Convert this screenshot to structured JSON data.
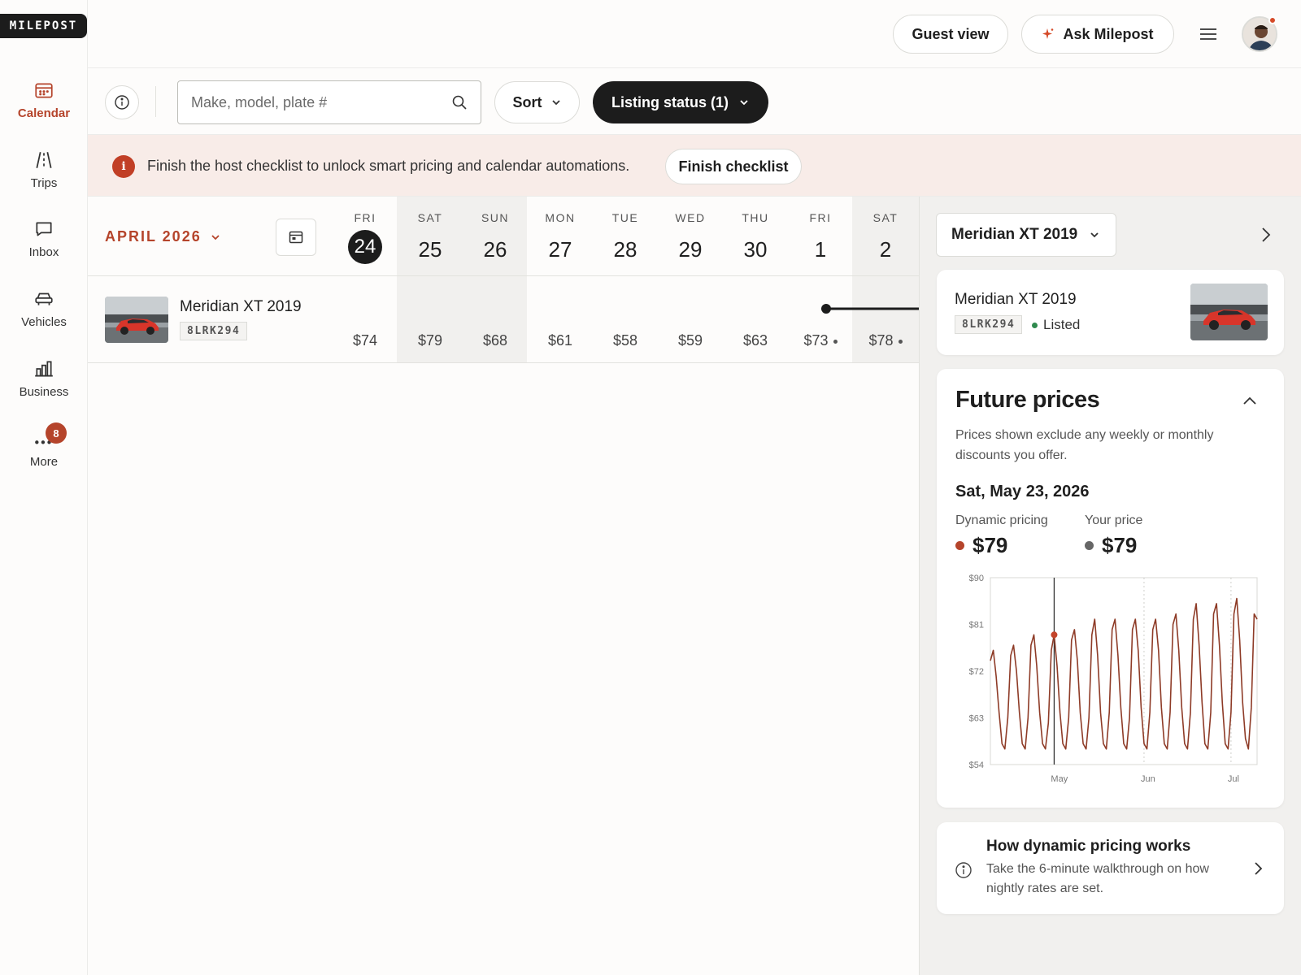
{
  "brand": {
    "logo": "MILEPOST"
  },
  "sidebar": {
    "items": [
      {
        "label": "Calendar",
        "icon": "calendar-icon",
        "active": true
      },
      {
        "label": "Trips",
        "icon": "road-icon"
      },
      {
        "label": "Inbox",
        "icon": "chat-icon"
      },
      {
        "label": "Vehicles",
        "icon": "car-icon"
      },
      {
        "label": "Business",
        "icon": "bar-chart-icon"
      },
      {
        "label": "More",
        "icon": "more-icon",
        "badge": "8"
      }
    ]
  },
  "header": {
    "guest_view": "Guest view",
    "ask": "Ask Milepost",
    "menu_icon": "hamburger-icon"
  },
  "filters": {
    "search_placeholder": "Make, model, plate #",
    "sort": "Sort",
    "listing_status": "Listing status (1)"
  },
  "banner": {
    "icon_text": "i",
    "text": "Finish the host checklist to unlock smart pricing and calendar automations.",
    "button": "Finish checklist"
  },
  "calendar": {
    "month": "APRIL 2026",
    "days": [
      {
        "dow": "FRI",
        "num": "24",
        "today": true
      },
      {
        "dow": "SAT",
        "num": "25",
        "weekend": true
      },
      {
        "dow": "SUN",
        "num": "26",
        "weekend": true
      },
      {
        "dow": "MON",
        "num": "27"
      },
      {
        "dow": "TUE",
        "num": "28"
      },
      {
        "dow": "WED",
        "num": "29"
      },
      {
        "dow": "THU",
        "num": "30"
      },
      {
        "dow": "FRI",
        "num": "1"
      },
      {
        "dow": "SAT",
        "num": "2",
        "weekend": true
      }
    ],
    "vehicle": {
      "name": "Meridian XT 2019",
      "plate": "8LRK294",
      "prices": [
        "$74",
        "$79",
        "$68",
        "$61",
        "$58",
        "$59",
        "$63",
        "$73",
        "$78"
      ],
      "price_dot_indices": [
        7,
        8
      ]
    }
  },
  "panel": {
    "vehicle_select": "Meridian XT 2019",
    "vehicle_card": {
      "name": "Meridian XT 2019",
      "plate": "8LRK294",
      "status": "Listed",
      "status_color": "#2f8a4e"
    },
    "future_prices": {
      "title": "Future prices",
      "subtitle": "Prices shown exclude any weekly or monthly discounts you offer.",
      "date": "Sat, May 23, 2026",
      "dynamic_label": "Dynamic pricing",
      "dynamic_value": "$79",
      "dynamic_color": "#b5442b",
      "your_label": "Your price",
      "your_value": "$79",
      "your_color": "#666666"
    },
    "how": {
      "title": "How dynamic pricing works",
      "subtitle": "Take the 6-minute walkthrough on how nightly rates are set."
    }
  },
  "chart_data": {
    "type": "line",
    "y_tick_labels": [
      "$90",
      "$81",
      "$72",
      "$63",
      "$54"
    ],
    "ylim": [
      54,
      90
    ],
    "x_tick_labels": [
      "May",
      "Jun",
      "Jul"
    ],
    "x_tick_days": [
      0,
      31,
      61
    ],
    "x_range_days": [
      -22,
      70
    ],
    "grid": "dashed vertical at month starts",
    "cursor_day": 0,
    "marker": {
      "day": 0,
      "value": 79
    },
    "line_color": "#8e3b27",
    "series": [
      {
        "points": [
          [
            -22,
            74
          ],
          [
            -21,
            76
          ],
          [
            -20,
            71
          ],
          [
            -19,
            64
          ],
          [
            -18,
            58
          ],
          [
            -17,
            57
          ],
          [
            -16,
            63
          ],
          [
            -15,
            75
          ],
          [
            -14,
            77
          ],
          [
            -13,
            72
          ],
          [
            -12,
            64
          ],
          [
            -11,
            58
          ],
          [
            -10,
            57
          ],
          [
            -9,
            63
          ],
          [
            -8,
            77
          ],
          [
            -7,
            79
          ],
          [
            -6,
            73
          ],
          [
            -5,
            64
          ],
          [
            -4,
            58
          ],
          [
            -3,
            57
          ],
          [
            -2,
            62
          ],
          [
            -1,
            76
          ],
          [
            0,
            79
          ],
          [
            1,
            73
          ],
          [
            2,
            64
          ],
          [
            3,
            58
          ],
          [
            4,
            57
          ],
          [
            5,
            63
          ],
          [
            6,
            78
          ],
          [
            7,
            80
          ],
          [
            8,
            74
          ],
          [
            9,
            64
          ],
          [
            10,
            58
          ],
          [
            11,
            57
          ],
          [
            12,
            63
          ],
          [
            13,
            79
          ],
          [
            14,
            82
          ],
          [
            15,
            75
          ],
          [
            16,
            64
          ],
          [
            17,
            58
          ],
          [
            18,
            57
          ],
          [
            19,
            64
          ],
          [
            20,
            80
          ],
          [
            21,
            82
          ],
          [
            22,
            75
          ],
          [
            23,
            65
          ],
          [
            24,
            58
          ],
          [
            25,
            57
          ],
          [
            26,
            63
          ],
          [
            27,
            80
          ],
          [
            28,
            82
          ],
          [
            29,
            76
          ],
          [
            30,
            65
          ],
          [
            31,
            58
          ],
          [
            32,
            57
          ],
          [
            33,
            64
          ],
          [
            34,
            80
          ],
          [
            35,
            82
          ],
          [
            36,
            76
          ],
          [
            37,
            65
          ],
          [
            38,
            58
          ],
          [
            39,
            57
          ],
          [
            40,
            64
          ],
          [
            41,
            81
          ],
          [
            42,
            83
          ],
          [
            43,
            76
          ],
          [
            44,
            65
          ],
          [
            45,
            58
          ],
          [
            46,
            57
          ],
          [
            47,
            64
          ],
          [
            48,
            82
          ],
          [
            49,
            85
          ],
          [
            50,
            77
          ],
          [
            51,
            66
          ],
          [
            52,
            58
          ],
          [
            53,
            57
          ],
          [
            54,
            64
          ],
          [
            55,
            83
          ],
          [
            56,
            85
          ],
          [
            57,
            77
          ],
          [
            58,
            66
          ],
          [
            59,
            58
          ],
          [
            60,
            57
          ],
          [
            61,
            64
          ],
          [
            62,
            83
          ],
          [
            63,
            86
          ],
          [
            64,
            78
          ],
          [
            65,
            66
          ],
          [
            66,
            59
          ],
          [
            67,
            57
          ],
          [
            68,
            65
          ],
          [
            69,
            83
          ],
          [
            70,
            82
          ]
        ]
      }
    ]
  }
}
